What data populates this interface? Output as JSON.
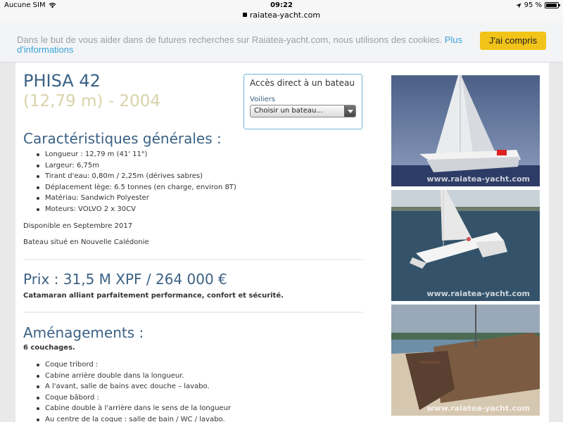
{
  "status": {
    "carrier": "Aucune SIM",
    "time": "09:22",
    "battery_text": "95 %",
    "battery_level": 0.95
  },
  "url": {
    "host": "raiatea-yacht.com"
  },
  "cookie": {
    "message": "Dans le but de vous aider dans de futures recherches sur Raiatea-yacht.com, nous utilisons des cookies.",
    "link": "Plus d'informations",
    "button": "J'ai compris"
  },
  "boat": {
    "name": "PHISA 42",
    "subtitle": "(12,79 m) - 2004"
  },
  "access": {
    "title": "Accès direct à un bateau",
    "label": "Voiliers",
    "select_value": "Choisir un bateau..."
  },
  "general": {
    "heading": "Caractéristiques générales :",
    "items": [
      "Longueur : 12,79 m (41' 11\")",
      "Largeur: 6,75m",
      "Tirant d'eau: 0,80m / 2,25m (dérives sabres)",
      "Déplacement lège: 6.5 tonnes (en charge, environ 8T)",
      "Matériau: Sandwich Polyester",
      "Moteurs: VOLVO 2 x 30CV"
    ],
    "available": "Disponible en Septembre 2017",
    "location": "Bateau situé en Nouvelle Calédonie"
  },
  "price": {
    "heading": "Prix : 31,5 M XPF / 264 000 €",
    "tagline": "Catamaran alliant parfaitement performance, confort et sécurité."
  },
  "amenagements": {
    "heading": "Aménagements :",
    "beds": "6 couchages.",
    "items": [
      "Coque tribord :",
      "Cabine arrière double dans la longueur.",
      "A l'avant, salle de bains avec douche – lavabo.",
      "Coque bâbord :",
      "Cabine double à l'arrière dans le sens de la longueur",
      "Au centre de la coque : salle de bain / WC / lavabo."
    ]
  },
  "photos": {
    "watermark": "www.raiatea-yacht.com"
  }
}
